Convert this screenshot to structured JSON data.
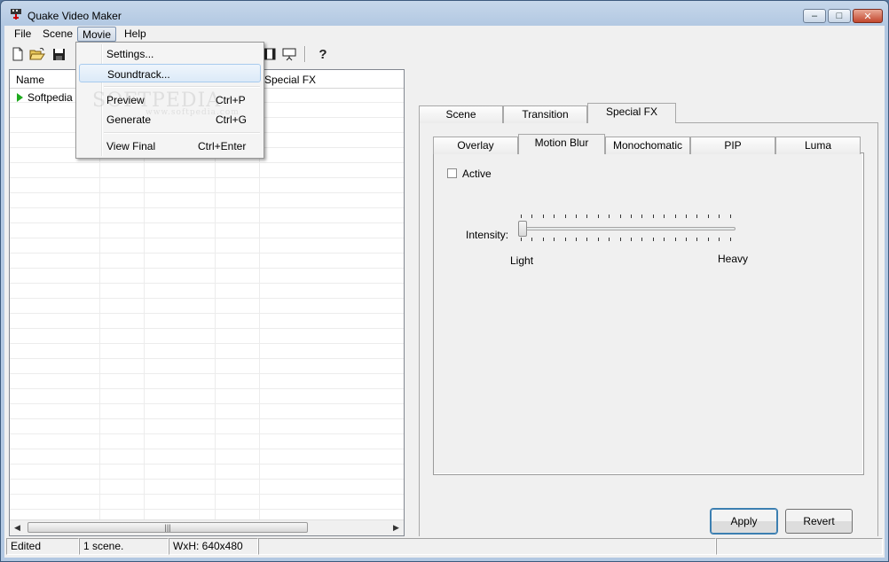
{
  "window": {
    "title": "Quake Video Maker",
    "controls": {
      "minimize": "–",
      "maximize": "□",
      "close": "✕"
    }
  },
  "menubar": {
    "items": [
      "File",
      "Scene",
      "Movie",
      "Help"
    ],
    "open_menu": "Movie"
  },
  "movie_menu": {
    "items": [
      {
        "label": "Settings...",
        "shortcut": ""
      },
      {
        "label": "Soundtrack...",
        "shortcut": ""
      },
      {
        "label": "Preview",
        "shortcut": "Ctrl+P"
      },
      {
        "label": "Generate",
        "shortcut": "Ctrl+G"
      },
      {
        "label": "View Final",
        "shortcut": "Ctrl+Enter"
      }
    ],
    "highlighted": "Soundtrack..."
  },
  "toolbar": {
    "icons": [
      "new-icon",
      "open-icon",
      "save-icon",
      "film-icon",
      "presentation-icon",
      "help-icon"
    ],
    "help_glyph": "?"
  },
  "scene_list": {
    "columns": [
      "Name",
      "Special FX"
    ],
    "rows": [
      {
        "name": "Softpedia",
        "status_icon": "play-icon"
      }
    ],
    "scroll_thumb_glyph": "|||",
    "left_arrow": "◀",
    "right_arrow": "▶"
  },
  "properties": {
    "main_tabs": [
      "Scene",
      "Transition",
      "Special FX"
    ],
    "active_main_tab": "Special FX",
    "fx_tabs": [
      "Overlay",
      "Motion Blur",
      "Monochomatic",
      "PIP",
      "Luma"
    ],
    "active_fx_tab": "Motion Blur",
    "active_checkbox": {
      "label": "Active",
      "checked": false
    },
    "intensity": {
      "label": "Intensity:",
      "min_label": "Light",
      "max_label": "Heavy",
      "value": 0
    }
  },
  "buttons": {
    "apply": "Apply",
    "revert": "Revert"
  },
  "statusbar": [
    "Edited",
    "1 scene.",
    "WxH: 640x480",
    "",
    ""
  ],
  "watermark": {
    "text": "SOFTPEDIA",
    "sub": "www.softpedia.com"
  },
  "colors": {
    "window_frame": "#b2c8e2",
    "play_green": "#1faa1f",
    "menu_highlight": "#dceaf8"
  }
}
